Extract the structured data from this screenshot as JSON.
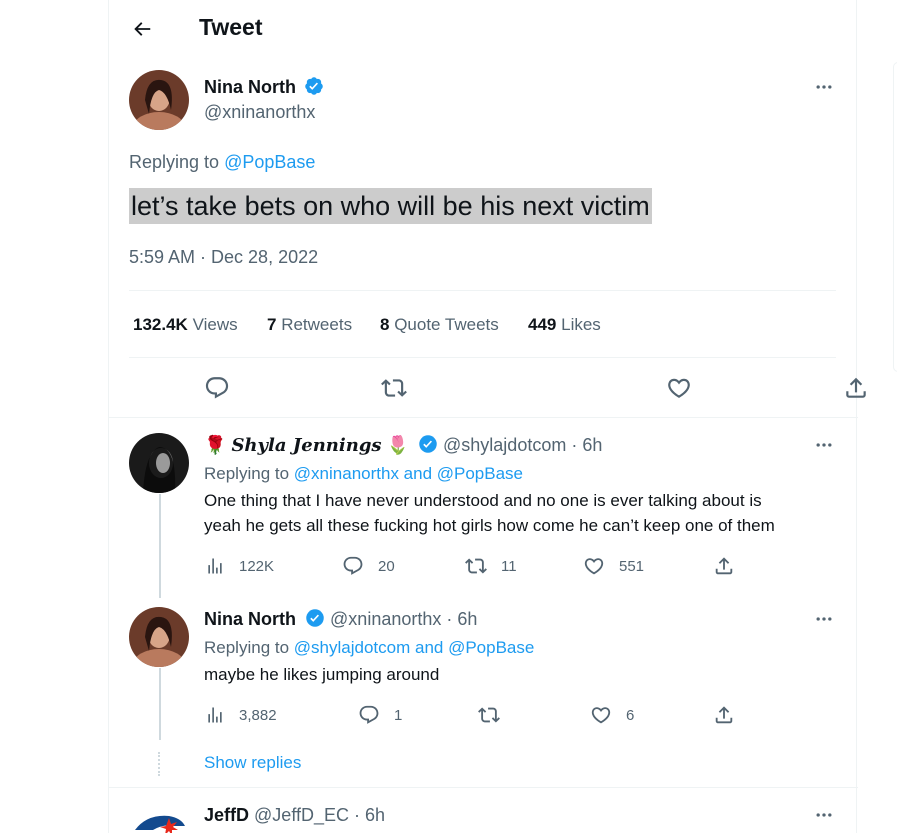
{
  "header": {
    "title": "Tweet"
  },
  "main_tweet": {
    "name": "Nina North",
    "handle": "@xninanorthx",
    "replying_label": "Replying to",
    "replying_to": "@PopBase",
    "text": "let’s take bets on who will be his next victim",
    "timestamp": "5:59 AM · Dec 28, 2022",
    "stats": {
      "views_num": "132.4K",
      "views_label": "Views",
      "retweets_num": "7",
      "retweets_label": "Retweets",
      "quotes_num": "8",
      "quotes_label": "Quote Tweets",
      "likes_num": "449",
      "likes_label": "Likes"
    }
  },
  "replies": [
    {
      "name": "Shyla Jennings",
      "handle": "@shylajdotcom",
      "time": "· 6h",
      "replying_label": "Replying to",
      "replying_to": "@xninanorthx and @PopBase",
      "text_line1": "One thing that I have never understood and no one is ever talking about is",
      "text_line2": "yeah he gets all these fucking hot girls how come he can’t keep one of them",
      "views": "122K",
      "replies": "20",
      "retweets": "11",
      "likes": "551"
    },
    {
      "name": "Nina North",
      "handle": "@xninanorthx",
      "time": "· 6h",
      "replying_label": "Replying to",
      "replying_to": "@shylajdotcom and @PopBase",
      "text_line1": "maybe he likes jumping around",
      "views": "3,882",
      "replies": "1",
      "retweets": "",
      "likes": "6"
    }
  ],
  "show_replies": "Show replies",
  "next_tweet": {
    "name": "JeffD",
    "handle": "@JeffD_EC",
    "time": "· 6h"
  },
  "colors": {
    "accent": "#1d9bf0",
    "text": "#0f1419",
    "secondary": "#536471",
    "border": "#eff3f4",
    "highlight": "#cccccc"
  }
}
